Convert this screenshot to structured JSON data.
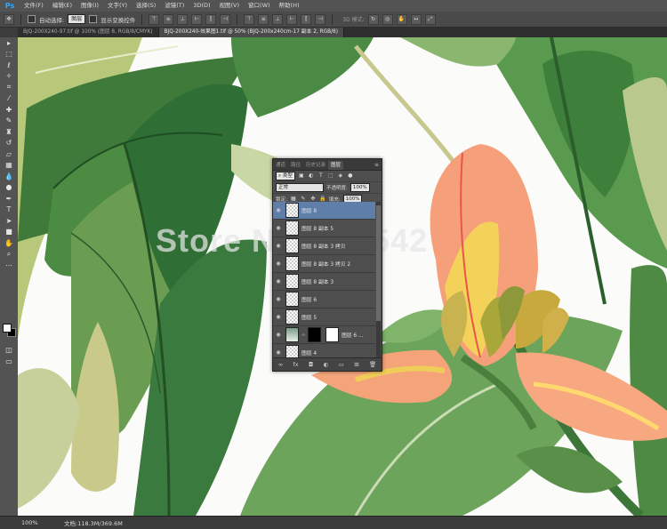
{
  "app": {
    "logo": "Ps"
  },
  "menu": [
    "文件(F)",
    "编辑(E)",
    "图像(I)",
    "文字(Y)",
    "选择(S)",
    "滤镜(T)",
    "3D(D)",
    "视图(V)",
    "窗口(W)",
    "帮助(H)"
  ],
  "options": {
    "auto_select_label": "自动选择:",
    "auto_select_value": "图层",
    "show_transform_label": "显示变换控件",
    "mode_3d_label": "3D 模式:"
  },
  "tabs": [
    {
      "label": "BJQ-200X240-97.tif @ 100% (图层 8, RGB/8/CMYK)"
    },
    {
      "label": "BJQ-200X240-效果图1.tif @ 50% (BJQ-200x240cm-17 副本 2, RGB/8)"
    }
  ],
  "status": {
    "zoom": "100%",
    "doc_info": "文档:118.3M/369.6M"
  },
  "layers_panel": {
    "tabs": [
      "通道",
      "路径",
      "历史记录",
      "图层"
    ],
    "filter_kind": "类型",
    "blend_mode": "正常",
    "opacity_label": "不透明度:",
    "opacity_value": "100%",
    "lock_label": "锁定:",
    "fill_label": "填充:",
    "fill_value": "100%",
    "layers": [
      {
        "name": "图层 8",
        "selected": true
      },
      {
        "name": "图层 8 副本 5"
      },
      {
        "name": "图层 8 副本 3 拷贝"
      },
      {
        "name": "图层 8 副本 3 拷贝 2"
      },
      {
        "name": "图层 8 副本 3"
      },
      {
        "name": "图层 6"
      },
      {
        "name": "图层 5"
      },
      {
        "name": "图层 6 ..."
      },
      {
        "name": "图层 4"
      }
    ]
  },
  "watermark": "Store No. 518542",
  "colors": {
    "accent": "#5f7eaa",
    "ps_blue": "#31a8ff"
  }
}
